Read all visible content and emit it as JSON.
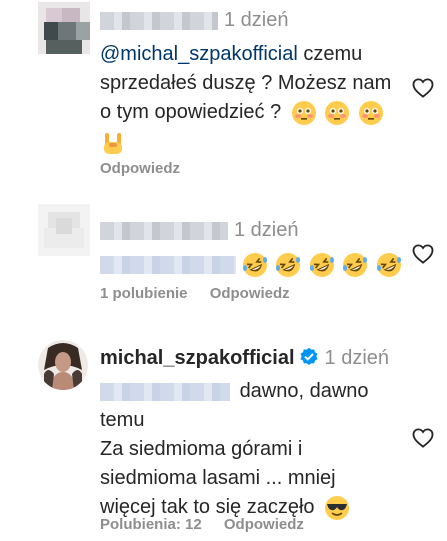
{
  "comments": [
    {
      "username_hidden": true,
      "time": "1 dzień",
      "mention": "@michal_szpakofficial",
      "text_lines": [
        "czemu",
        "sprzedałeś duszę ? Możesz nam",
        "o tym opowiedzieć ?"
      ],
      "emojis": [
        "flushed-face",
        "flushed-face",
        "flushed-face",
        "sign-of-horns"
      ],
      "reply_label": "Odpowiedz"
    },
    {
      "username_hidden": true,
      "time": "1 dzień",
      "emojis": [
        "rolling-laughing-face",
        "rolling-laughing-face",
        "rolling-laughing-face",
        "rolling-laughing-face",
        "rolling-laughing-face"
      ],
      "likes_label": "1 polubienie",
      "reply_label": "Odpowiedz"
    },
    {
      "username": "michal_szpakofficial",
      "verified": true,
      "time": "1 dzień",
      "text_lines": [
        "dawno, dawno",
        "temu",
        "Za siedmioma górami i",
        "siedmioma lasami ... mniej",
        "więcej tak to się zaczęło"
      ],
      "emojis": [
        "smiling-face-with-sunglasses"
      ],
      "likes_label": "Polubienia: 12",
      "reply_label": "Odpowiedz"
    }
  ],
  "colors": {
    "text": "#262626",
    "secondary": "#8e8e8e",
    "mention": "#00376b",
    "verified": "#0095f6"
  }
}
